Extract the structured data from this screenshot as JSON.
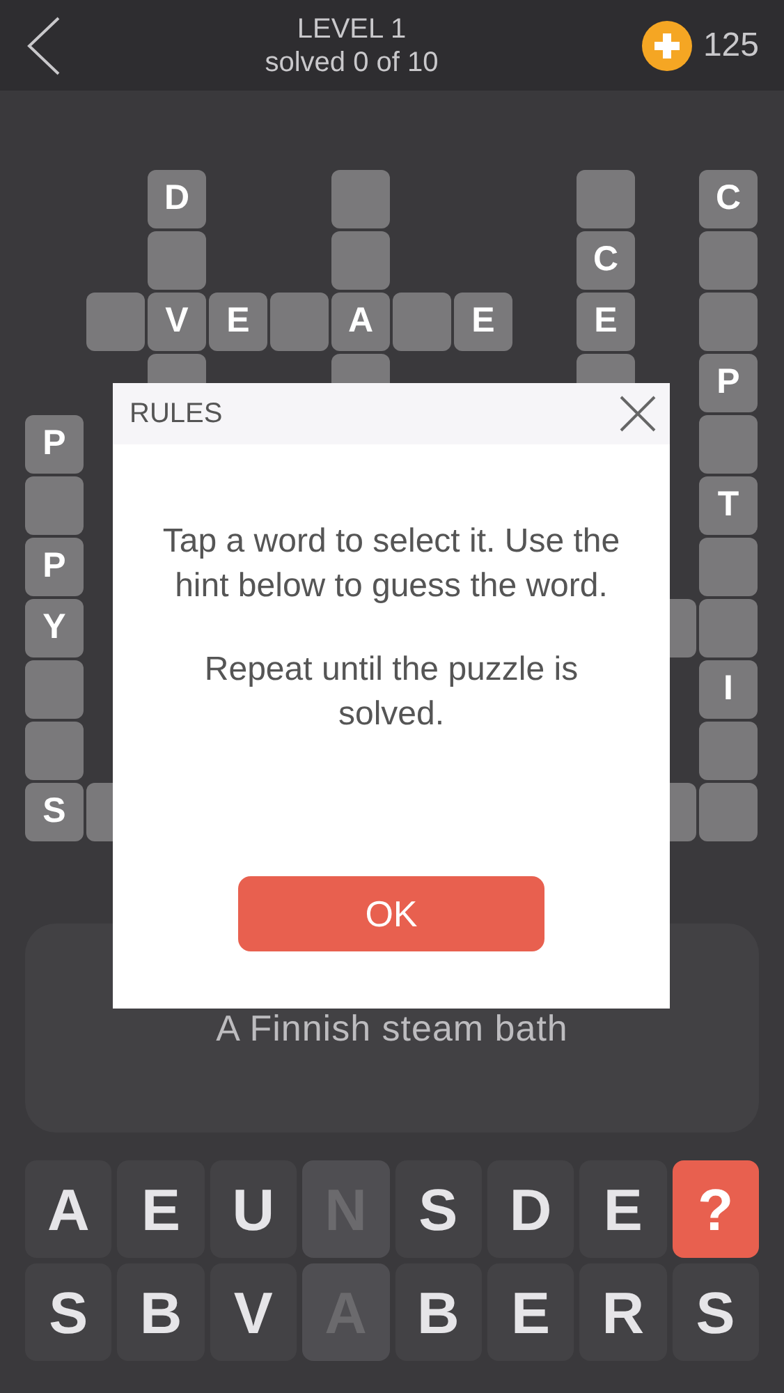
{
  "header": {
    "title": "LEVEL 1",
    "subtitle": "solved 0 of 10",
    "coins": "125"
  },
  "grid": [
    [
      {
        "kind": "gap"
      },
      {
        "kind": "gap"
      },
      {
        "kind": "tile",
        "letter": "D"
      },
      {
        "kind": "gap"
      },
      {
        "kind": "gap"
      },
      {
        "kind": "tile"
      },
      {
        "kind": "gap"
      },
      {
        "kind": "gap"
      },
      {
        "kind": "gap"
      },
      {
        "kind": "tile"
      },
      {
        "kind": "gap"
      },
      {
        "kind": "tile",
        "letter": "C"
      }
    ],
    [
      {
        "kind": "gap"
      },
      {
        "kind": "gap"
      },
      {
        "kind": "tile"
      },
      {
        "kind": "gap"
      },
      {
        "kind": "gap"
      },
      {
        "kind": "tile"
      },
      {
        "kind": "gap"
      },
      {
        "kind": "gap"
      },
      {
        "kind": "gap"
      },
      {
        "kind": "tile",
        "letter": "C"
      },
      {
        "kind": "gap"
      },
      {
        "kind": "tile"
      }
    ],
    [
      {
        "kind": "gap"
      },
      {
        "kind": "tile"
      },
      {
        "kind": "tile",
        "letter": "V"
      },
      {
        "kind": "tile",
        "letter": "E"
      },
      {
        "kind": "tile"
      },
      {
        "kind": "tile",
        "letter": "A"
      },
      {
        "kind": "tile"
      },
      {
        "kind": "tile",
        "letter": "E"
      },
      {
        "kind": "gap"
      },
      {
        "kind": "tile",
        "letter": "E"
      },
      {
        "kind": "gap"
      },
      {
        "kind": "tile"
      }
    ],
    [
      {
        "kind": "gap"
      },
      {
        "kind": "gap"
      },
      {
        "kind": "tile"
      },
      {
        "kind": "gap"
      },
      {
        "kind": "gap"
      },
      {
        "kind": "tile"
      },
      {
        "kind": "gap"
      },
      {
        "kind": "gap"
      },
      {
        "kind": "gap"
      },
      {
        "kind": "tile"
      },
      {
        "kind": "gap"
      },
      {
        "kind": "tile",
        "letter": "P"
      }
    ],
    [
      {
        "kind": "tile",
        "letter": "P"
      },
      {
        "kind": "gap"
      },
      {
        "kind": "gap"
      },
      {
        "kind": "gap"
      },
      {
        "kind": "gap"
      },
      {
        "kind": "gap"
      },
      {
        "kind": "gap"
      },
      {
        "kind": "gap"
      },
      {
        "kind": "gap"
      },
      {
        "kind": "gap"
      },
      {
        "kind": "gap"
      },
      {
        "kind": "tile"
      }
    ],
    [
      {
        "kind": "tile"
      },
      {
        "kind": "gap"
      },
      {
        "kind": "gap"
      },
      {
        "kind": "gap"
      },
      {
        "kind": "gap"
      },
      {
        "kind": "gap"
      },
      {
        "kind": "gap"
      },
      {
        "kind": "gap"
      },
      {
        "kind": "gap"
      },
      {
        "kind": "gap"
      },
      {
        "kind": "gap"
      },
      {
        "kind": "tile",
        "letter": "T"
      }
    ],
    [
      {
        "kind": "tile",
        "letter": "P"
      },
      {
        "kind": "gap"
      },
      {
        "kind": "gap"
      },
      {
        "kind": "gap"
      },
      {
        "kind": "gap"
      },
      {
        "kind": "gap"
      },
      {
        "kind": "gap"
      },
      {
        "kind": "gap"
      },
      {
        "kind": "gap"
      },
      {
        "kind": "gap"
      },
      {
        "kind": "gap"
      },
      {
        "kind": "tile"
      }
    ],
    [
      {
        "kind": "tile",
        "letter": "Y"
      },
      {
        "kind": "gap"
      },
      {
        "kind": "gap"
      },
      {
        "kind": "gap"
      },
      {
        "kind": "gap"
      },
      {
        "kind": "gap"
      },
      {
        "kind": "gap"
      },
      {
        "kind": "gap"
      },
      {
        "kind": "gap"
      },
      {
        "kind": "gap"
      },
      {
        "kind": "tile"
      },
      {
        "kind": "tile"
      }
    ],
    [
      {
        "kind": "tile"
      },
      {
        "kind": "gap"
      },
      {
        "kind": "gap"
      },
      {
        "kind": "gap"
      },
      {
        "kind": "gap"
      },
      {
        "kind": "gap"
      },
      {
        "kind": "gap"
      },
      {
        "kind": "gap"
      },
      {
        "kind": "gap"
      },
      {
        "kind": "gap"
      },
      {
        "kind": "gap"
      },
      {
        "kind": "tile",
        "letter": "I"
      }
    ],
    [
      {
        "kind": "tile"
      },
      {
        "kind": "gap"
      },
      {
        "kind": "gap"
      },
      {
        "kind": "gap"
      },
      {
        "kind": "gap"
      },
      {
        "kind": "gap"
      },
      {
        "kind": "gap"
      },
      {
        "kind": "gap"
      },
      {
        "kind": "gap"
      },
      {
        "kind": "gap"
      },
      {
        "kind": "gap"
      },
      {
        "kind": "tile"
      }
    ],
    [
      {
        "kind": "tile",
        "letter": "S"
      },
      {
        "kind": "tile"
      },
      {
        "kind": "gap"
      },
      {
        "kind": "gap"
      },
      {
        "kind": "gap"
      },
      {
        "kind": "gap"
      },
      {
        "kind": "gap"
      },
      {
        "kind": "gap"
      },
      {
        "kind": "gap"
      },
      {
        "kind": "gap"
      },
      {
        "kind": "tile"
      },
      {
        "kind": "tile"
      }
    ]
  ],
  "hint": "A Finnish steam bath",
  "keyboard": {
    "rows": [
      {
        "keys": [
          {
            "kind": "letter",
            "label": "A",
            "used": false
          },
          {
            "kind": "letter",
            "label": "E",
            "used": false
          },
          {
            "kind": "letter",
            "label": "U",
            "used": false
          },
          {
            "kind": "letter",
            "label": "N",
            "used": true
          },
          {
            "kind": "letter",
            "label": "S",
            "used": false
          },
          {
            "kind": "letter",
            "label": "D",
            "used": false
          },
          {
            "kind": "letter",
            "label": "E",
            "used": false
          },
          {
            "kind": "help",
            "label": "?"
          }
        ]
      },
      {
        "keys": [
          {
            "kind": "letter",
            "label": "S",
            "used": false
          },
          {
            "kind": "letter",
            "label": "B",
            "used": false
          },
          {
            "kind": "letter",
            "label": "V",
            "used": false
          },
          {
            "kind": "letter",
            "label": "A",
            "used": true
          },
          {
            "kind": "letter",
            "label": "B",
            "used": false
          },
          {
            "kind": "letter",
            "label": "E",
            "used": false
          },
          {
            "kind": "letter",
            "label": "R",
            "used": false
          },
          {
            "kind": "letter",
            "label": "S",
            "used": false
          }
        ]
      }
    ]
  },
  "dialog": {
    "title": "RULES",
    "paragraphs": [
      "Tap a word to select it. Use the hint below to guess the word.",
      "Repeat until the puzzle is solved."
    ],
    "button": "OK"
  }
}
